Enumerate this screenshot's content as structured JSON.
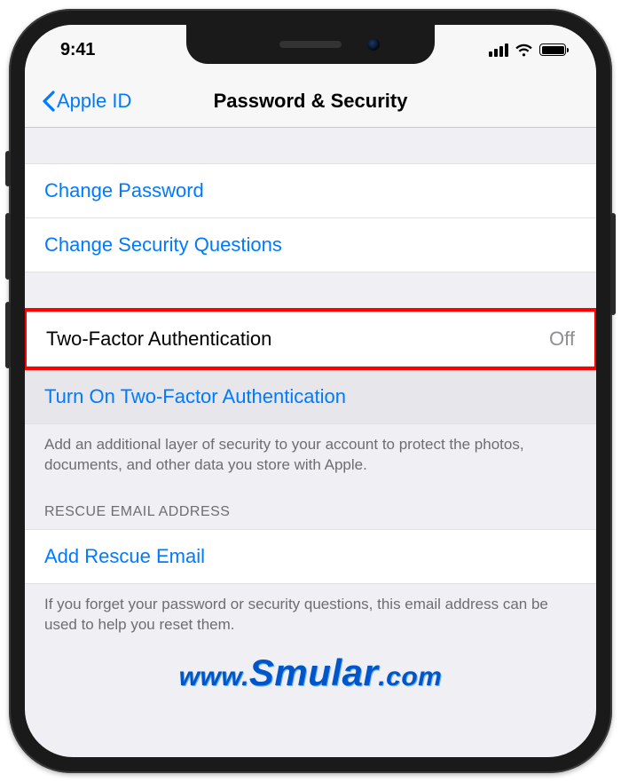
{
  "status": {
    "time": "9:41"
  },
  "nav": {
    "back_label": "Apple ID",
    "title": "Password & Security"
  },
  "cells": {
    "change_password": "Change Password",
    "change_security_questions": "Change Security Questions",
    "two_factor_label": "Two-Factor Authentication",
    "two_factor_value": "Off",
    "turn_on_2fa": "Turn On Two-Factor Authentication",
    "two_factor_footer": "Add an additional layer of security to your account to protect the photos, documents, and other data you store with Apple.",
    "rescue_header": "RESCUE EMAIL ADDRESS",
    "add_rescue_email": "Add Rescue Email",
    "rescue_footer": "If you forget your password or security questions, this email address can be used to help you reset them."
  },
  "watermark": {
    "prefix": "www.",
    "brand": "Smular",
    "suffix": ".com"
  }
}
